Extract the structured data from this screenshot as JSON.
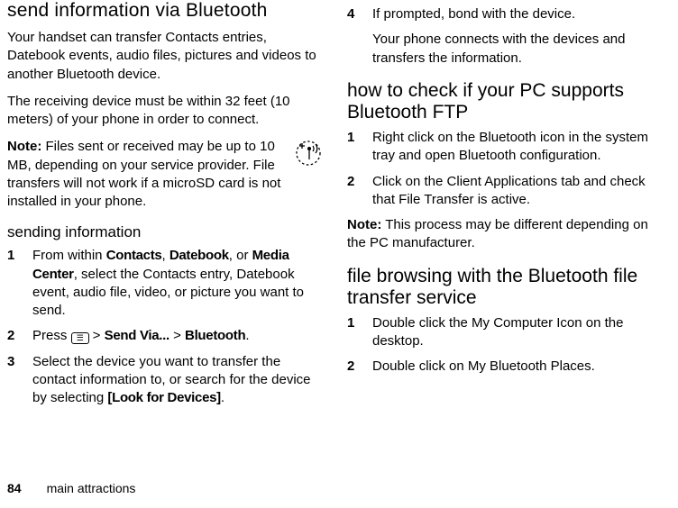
{
  "left": {
    "h1": "send information via Bluetooth",
    "p1": "Your handset can transfer Contacts entries, Datebook events, audio files, pictures and videos to another Bluetooth device.",
    "p2": "The receiving device must be within 32 feet (10 meters) of your phone in order to connect.",
    "note_label": "Note:",
    "note_body": " Files sent or received may be up to 10 MB, depending on your service provider. File transfers will not work if a microSD card is not installed in your phone.",
    "icon_name": "antenna-plus-icon",
    "h2": "sending information",
    "step1_pre": "From within ",
    "step1_contacts": "Contacts",
    "step1_sep1": ", ",
    "step1_datebook": "Datebook",
    "step1_sep2": ", or ",
    "step1_media": "Media Center",
    "step1_post": ", select the Contacts entry, Datebook event, audio file, video, or picture you want to send.",
    "step2_press": "Press ",
    "step2_key": "☰",
    "step2_gt1": " > ",
    "step2_sendvia": "Send Via...",
    "step2_gt2": " > ",
    "step2_bt": "Bluetooth",
    "step2_dot": ".",
    "step3_pre": "Select the device you want to transfer the contact information to, or search for the device by selecting ",
    "step3_look": "[Look for Devices]",
    "step3_dot": "."
  },
  "right": {
    "step4a": "If prompted, bond with the device.",
    "step4b": "Your phone connects with the devices and transfers the information.",
    "h1b": "how to check if your PC supports Bluetooth FTP",
    "pc1": "Right click on the Bluetooth icon in the system tray and open Bluetooth configuration.",
    "pc2": "Click on the Client Applications tab and check that File Transfer is active.",
    "note_label": "Note:",
    "note_body": " This process may be different depending on the PC manufacturer.",
    "h1c": "file browsing with the Bluetooth file transfer service",
    "fb1": "Double click the My Computer Icon on the desktop.",
    "fb2": "Double click on My Bluetooth Places."
  },
  "footer": {
    "page": "84",
    "section": "main attractions"
  }
}
